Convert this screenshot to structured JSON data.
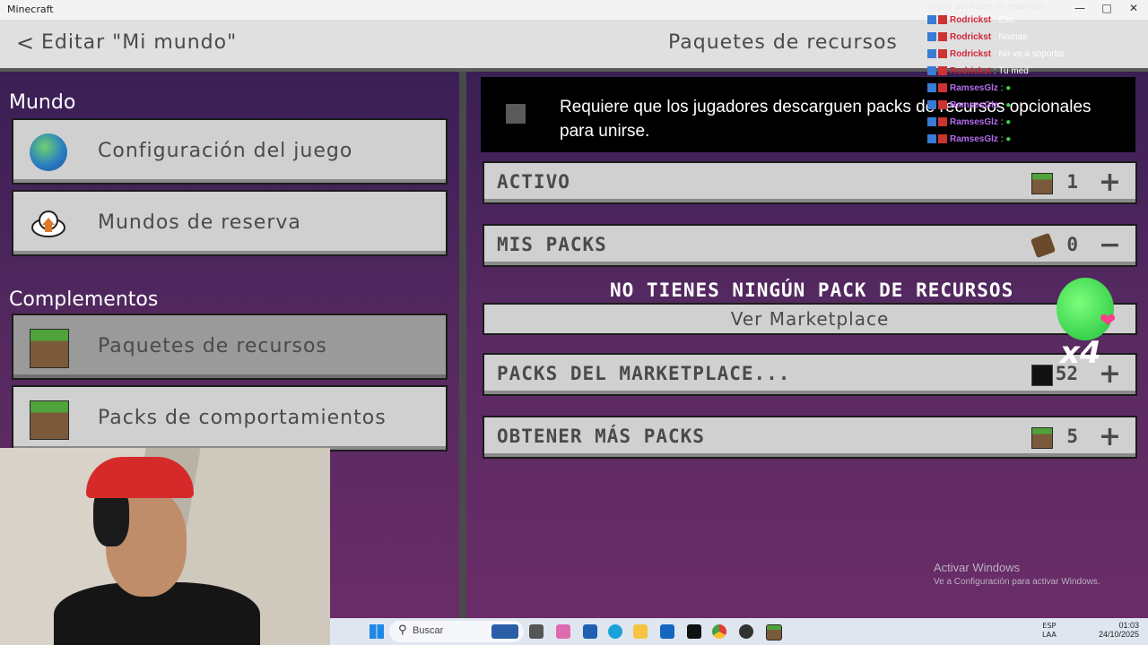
{
  "window": {
    "title": "Minecraft"
  },
  "header": {
    "back_glyph": "<",
    "title": "Editar \"Mi mundo\"",
    "right_title": "Paquetes de recursos"
  },
  "left": {
    "sections": [
      {
        "title": "Mundo"
      },
      {
        "title": "Complementos"
      }
    ],
    "items": [
      {
        "label": "Configuración del juego",
        "icon": "globe-icon"
      },
      {
        "label": "Mundos de reserva",
        "icon": "cloud-upload-icon"
      },
      {
        "label": "Paquetes de recursos",
        "icon": "grass-block-icon"
      },
      {
        "label": "Packs de comportamientos",
        "icon": "grass-block-icon"
      }
    ]
  },
  "right": {
    "notice": "Requiere que los jugadores descarguen packs de recursos opcionales para unirse.",
    "rows": [
      {
        "label": "ACTIVO",
        "count": "1",
        "action": "+"
      },
      {
        "label": "MIS PACKS",
        "count": "0",
        "action": "−"
      },
      {
        "label": "PACKS DEL MARKETPLACE...",
        "count": "52",
        "action": "+"
      },
      {
        "label": "OBTENER MÁS PACKS",
        "count": "5",
        "action": "+"
      }
    ],
    "empty_message": "NO TIENES NINGÚN PACK DE RECURSOS",
    "marketplace_button": "Ver Marketplace"
  },
  "watermark": {
    "title": "Activar Windows",
    "subtitle": "Ve a Configuración para activar Windows."
  },
  "chat": {
    "header": "tarjeta por hacer un realmsito",
    "messages": [
      {
        "user": "Rodrickst",
        "text": ": Eso",
        "color": "#d0263a"
      },
      {
        "user": "Rodrickst",
        "text": ": Nomas",
        "color": "#d0263a"
      },
      {
        "user": "Rodrickst",
        "text": ": No va a soportar",
        "color": "#d0263a"
      },
      {
        "user": "Rodrickst",
        "text": ": Tu med",
        "color": "#d0263a"
      },
      {
        "user": "RamsesGlz",
        "text": ":",
        "color": "#b76cf0"
      },
      {
        "user": "RamsesGlz",
        "text": ":",
        "color": "#b76cf0"
      },
      {
        "user": "RamsesGlz",
        "text": ":",
        "color": "#b76cf0"
      },
      {
        "user": "RamsesGlz",
        "text": ":",
        "color": "#b76cf0"
      }
    ]
  },
  "sticker": {
    "label": "x4"
  },
  "taskbar": {
    "search_placeholder": "Buscar",
    "lang_top": "ESP",
    "lang_bottom": "LAA",
    "time": "01:03",
    "date": "24/10/2025"
  }
}
